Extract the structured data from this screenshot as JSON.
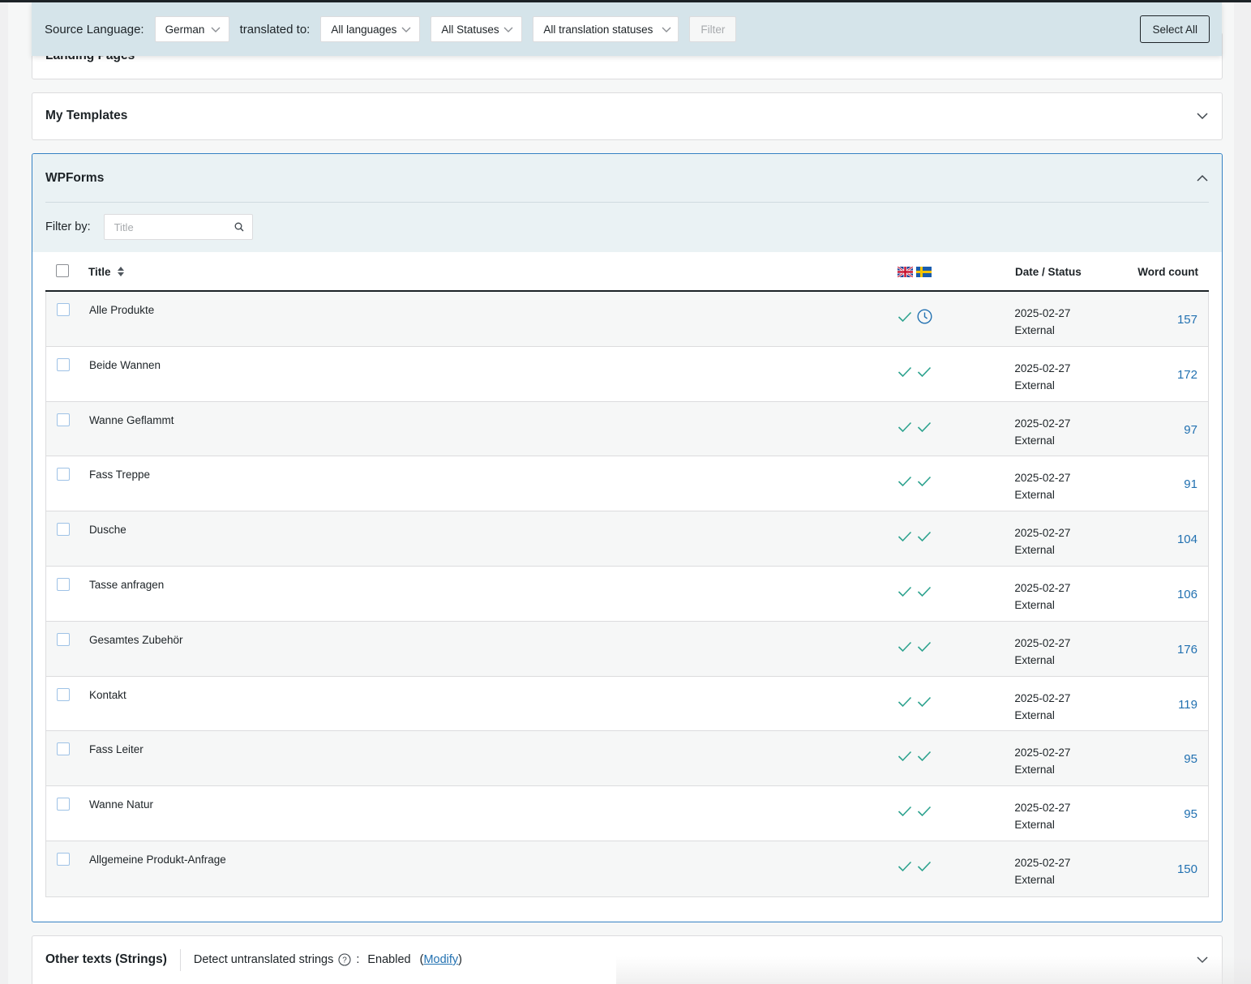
{
  "filterbar": {
    "source_label": "Source Language:",
    "source_value": "German",
    "translated_label": "translated to:",
    "lang_value": "All languages",
    "status_value": "All Statuses",
    "trans_status_value": "All translation statuses",
    "filter_label": "Filter",
    "select_all_label": "Select All"
  },
  "panels": {
    "landing_title": "Landing Pages",
    "templates_title": "My Templates",
    "wpforms_title": "WPForms",
    "strings_title": "Other texts (Strings)"
  },
  "wpforms": {
    "filter_by_label": "Filter by:",
    "search_placeholder": "Title"
  },
  "table": {
    "headers": {
      "title": "Title",
      "date_status": "Date / Status",
      "word_count": "Word count"
    },
    "flags": [
      "uk-flag-icon",
      "sweden-flag-icon"
    ],
    "rows": [
      {
        "title": "Alle Produkte",
        "date": "2025-02-27",
        "status": "External",
        "words": "157",
        "lang1": "check",
        "lang2": "clock"
      },
      {
        "title": "Beide Wannen",
        "date": "2025-02-27",
        "status": "External",
        "words": "172",
        "lang1": "check",
        "lang2": "check"
      },
      {
        "title": "Wanne Geflammt",
        "date": "2025-02-27",
        "status": "External",
        "words": "97",
        "lang1": "check",
        "lang2": "check"
      },
      {
        "title": "Fass Treppe",
        "date": "2025-02-27",
        "status": "External",
        "words": "91",
        "lang1": "check",
        "lang2": "check"
      },
      {
        "title": "Dusche",
        "date": "2025-02-27",
        "status": "External",
        "words": "104",
        "lang1": "check",
        "lang2": "check"
      },
      {
        "title": "Tasse anfragen",
        "date": "2025-02-27",
        "status": "External",
        "words": "106",
        "lang1": "check",
        "lang2": "check"
      },
      {
        "title": "Gesamtes Zubehör",
        "date": "2025-02-27",
        "status": "External",
        "words": "176",
        "lang1": "check",
        "lang2": "check"
      },
      {
        "title": "Kontakt",
        "date": "2025-02-27",
        "status": "External",
        "words": "119",
        "lang1": "check",
        "lang2": "check"
      },
      {
        "title": "Fass Leiter",
        "date": "2025-02-27",
        "status": "External",
        "words": "95",
        "lang1": "check",
        "lang2": "check"
      },
      {
        "title": "Wanne Natur",
        "date": "2025-02-27",
        "status": "External",
        "words": "95",
        "lang1": "check",
        "lang2": "check"
      },
      {
        "title": "Allgemeine Produkt-Anfrage",
        "date": "2025-02-27",
        "status": "External",
        "words": "150",
        "lang1": "check",
        "lang2": "check"
      }
    ]
  },
  "strings": {
    "detect_label": "Detect untranslated strings",
    "colon": ":",
    "enabled": "Enabled",
    "paren_open": "(",
    "modify": "Modify",
    "paren_close": ")"
  },
  "colors": {
    "accent": "#2271b1",
    "check": "#2ea38f",
    "filterbar_bg": "#d5e4ea"
  }
}
